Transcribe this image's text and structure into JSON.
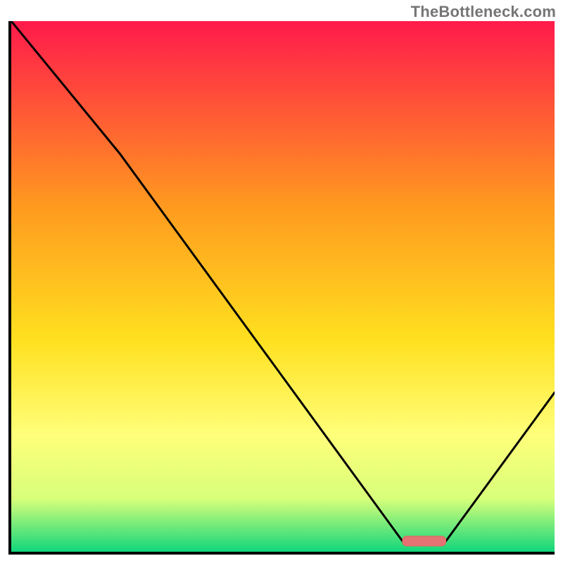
{
  "watermark": "TheBottleneck.com",
  "colors": {
    "axis": "#000000",
    "watermark": "#757575",
    "gradient_top": "#ff1a4b",
    "gradient_mid_upper": "#ff9a1f",
    "gradient_mid": "#ffe01f",
    "gradient_mid_lower": "#ffff7a",
    "gradient_lower": "#d8ff7a",
    "gradient_bottom": "#11d67b",
    "line": "#000000",
    "marker_fill": "#e57373",
    "marker_stroke": "#d9685f"
  },
  "chart_data": {
    "type": "line",
    "title": "",
    "xlabel": "",
    "ylabel": "",
    "xlim": [
      0,
      100
    ],
    "ylim": [
      0,
      100
    ],
    "x": [
      0,
      20,
      72,
      80,
      100
    ],
    "y": [
      100,
      75,
      2,
      2,
      30
    ],
    "optimal_range": {
      "x_start": 72,
      "x_end": 80,
      "y": 2
    },
    "gradient_stops": [
      {
        "offset": 0.0,
        "color": "#ff1a4b"
      },
      {
        "offset": 0.35,
        "color": "#ff9a1f"
      },
      {
        "offset": 0.6,
        "color": "#ffe01f"
      },
      {
        "offset": 0.78,
        "color": "#ffff7a"
      },
      {
        "offset": 0.9,
        "color": "#d8ff7a"
      },
      {
        "offset": 1.0,
        "color": "#11d67b"
      }
    ]
  }
}
